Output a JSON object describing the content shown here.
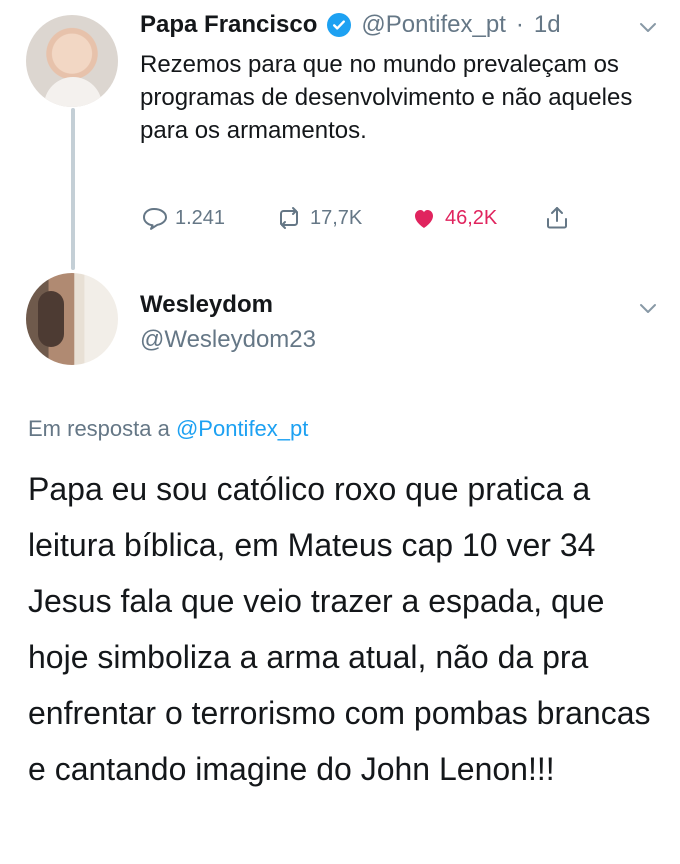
{
  "original_tweet": {
    "author": {
      "name": "Papa Francisco",
      "handle": "@Pontifex_pt",
      "separator": "·",
      "time": "1d",
      "verified": true
    },
    "text": "Rezemos para que no mundo prevaleçam os programas de desenvolvimento e não aqueles para os armamentos.",
    "actions": {
      "reply_count": "1.241",
      "retweet_count": "17,7K",
      "like_count": "46,2K",
      "icons": [
        "reply-icon",
        "retweet-icon",
        "heart-icon",
        "share-icon"
      ]
    }
  },
  "reply_tweet": {
    "author": {
      "name": "Wesleydom",
      "handle": "@Wesleydom23"
    },
    "reply_prefix": "Em resposta a",
    "reply_mention": "@Pontifex_pt",
    "text": "Papa eu sou católico roxo que pratica a leitura bíblica, em Mateus cap 10 ver 34 Jesus fala que veio trazer a espada, que hoje simboliza a arma atual, não da pra enfrentar o terrorismo com pombas brancas e cantando imagine do John Lenon!!!"
  },
  "colors": {
    "accent": "#1da1f2",
    "muted": "#657786",
    "like": "#e0245e",
    "thread_line": "#c4cfd6"
  }
}
